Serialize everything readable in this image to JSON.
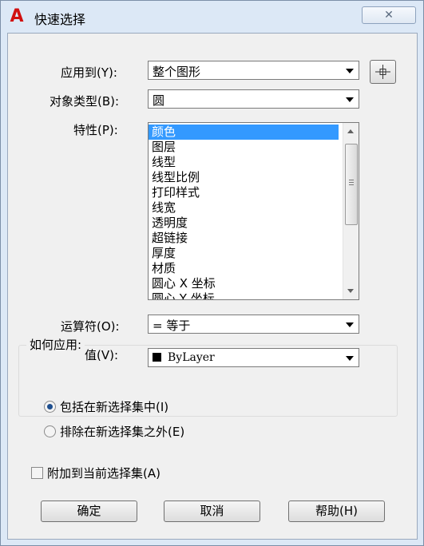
{
  "window": {
    "title": "快速选择",
    "app_icon": "autocad-icon",
    "close_glyph": "✕"
  },
  "form": {
    "apply_to": {
      "label": "应用到(Y):",
      "value": "整个图形"
    },
    "pick_button_icon": "crosshair-icon",
    "object_type": {
      "label": "对象类型(B):",
      "value": "圆"
    },
    "properties": {
      "label": "特性(P):",
      "items": [
        "颜色",
        "图层",
        "线型",
        "线型比例",
        "打印样式",
        "线宽",
        "透明度",
        "超链接",
        "厚度",
        "材质",
        "圆心 X 坐标",
        "圆心 Y 坐标"
      ],
      "selected_index": 0
    },
    "operator": {
      "label": "运算符(O):",
      "value": "= 等于"
    },
    "value": {
      "label": "值(V):",
      "value": "ByLayer",
      "swatch_color": "#000000"
    }
  },
  "how_to_apply": {
    "title": "如何应用:",
    "options": [
      {
        "label": "包括在新选择集中(I)",
        "checked": true
      },
      {
        "label": "排除在新选择集之外(E)",
        "checked": false
      }
    ]
  },
  "append": {
    "label": "附加到当前选择集(A)",
    "checked": false
  },
  "buttons": {
    "ok": "确定",
    "cancel": "取消",
    "help": "帮助(H)"
  }
}
